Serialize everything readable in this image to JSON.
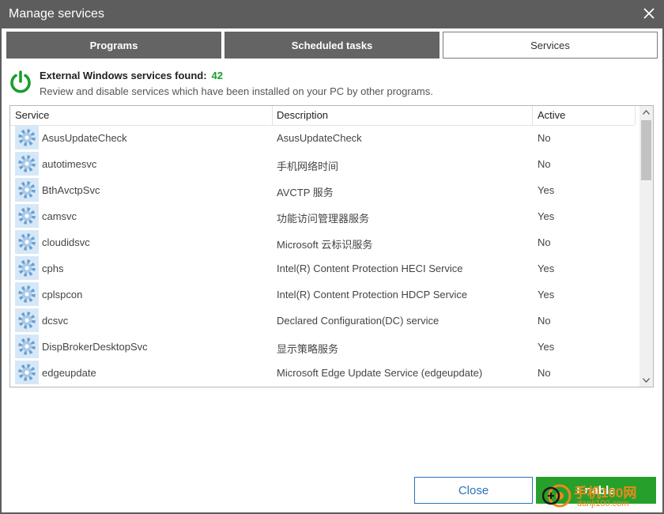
{
  "window": {
    "title": "Manage services",
    "close_icon": "close-icon"
  },
  "tabs": [
    {
      "label": "Programs",
      "active": false
    },
    {
      "label": "Scheduled tasks",
      "active": false
    },
    {
      "label": "Services",
      "active": true
    }
  ],
  "summary": {
    "icon": "power-icon",
    "found_label": "External Windows services found:",
    "found_count": "42",
    "description": "Review and disable services which have been installed on your PC by other programs."
  },
  "table": {
    "columns": [
      "Service",
      "Description",
      "Active"
    ],
    "rows": [
      {
        "service": "AsusUpdateCheck",
        "description": "AsusUpdateCheck",
        "active": "No"
      },
      {
        "service": "autotimesvc",
        "description": "手机网络时间",
        "active": "No"
      },
      {
        "service": "BthAvctpSvc",
        "description": "AVCTP 服务",
        "active": "Yes"
      },
      {
        "service": "camsvc",
        "description": "功能访问管理器服务",
        "active": "Yes"
      },
      {
        "service": "cloudidsvc",
        "description": "Microsoft 云标识服务",
        "active": "No"
      },
      {
        "service": "cphs",
        "description": "Intel(R) Content Protection HECI Service",
        "active": "Yes"
      },
      {
        "service": "cplspcon",
        "description": "Intel(R) Content Protection HDCP Service",
        "active": "Yes"
      },
      {
        "service": "dcsvc",
        "description": "Declared Configuration(DC) service",
        "active": "No"
      },
      {
        "service": "DispBrokerDesktopSvc",
        "description": "显示策略服务",
        "active": "Yes"
      },
      {
        "service": "edgeupdate",
        "description": "Microsoft Edge Update Service (edgeupdate)",
        "active": "No"
      }
    ]
  },
  "buttons": {
    "close_label": "Close",
    "enable_label": "Enable"
  },
  "watermark": {
    "brand": "手机100网",
    "url": "danji100.com"
  },
  "colors": {
    "accent_green": "#27a02b",
    "accent_blue": "#2b73b8",
    "titlebar": "#5d5d5d",
    "tab_inactive": "#646464"
  }
}
